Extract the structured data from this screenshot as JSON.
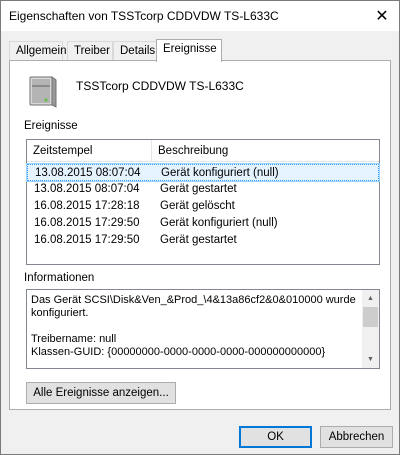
{
  "window": {
    "title": "Eigenschaften von TSSTcorp CDDVDW TS-L633C",
    "close_glyph": "✕"
  },
  "tabs": [
    {
      "label": "Allgemein"
    },
    {
      "label": "Treiber"
    },
    {
      "label": "Details"
    },
    {
      "label": "Ereignisse",
      "active": true
    }
  ],
  "device": {
    "icon": "computer-drive-icon",
    "name": "TSSTcorp CDDVDW TS-L633C"
  },
  "events": {
    "group_label": "Ereignisse",
    "columns": [
      "Zeitstempel",
      "Beschreibung"
    ],
    "rows": [
      {
        "timestamp": "13.08.2015 08:07:04",
        "description": "Gerät konfiguriert (null)",
        "selected": true
      },
      {
        "timestamp": "13.08.2015 08:07:04",
        "description": "Gerät gestartet"
      },
      {
        "timestamp": "16.08.2015 17:28:18",
        "description": "Gerät gelöscht"
      },
      {
        "timestamp": "16.08.2015 17:29:50",
        "description": "Gerät konfiguriert (null)"
      },
      {
        "timestamp": "16.08.2015 17:29:50",
        "description": "Gerät gestartet"
      }
    ]
  },
  "info": {
    "group_label": "Informationen",
    "text": "Das Gerät SCSI\\Disk&Ven_&Prod_\\4&13a86cf2&0&010000 wurde konfiguriert.\n\nTreibername: null\nKlassen-GUID: {00000000-0000-0000-0000-000000000000}"
  },
  "buttons": {
    "show_all": "Alle Ereignisse anzeigen...",
    "ok": "OK",
    "cancel": "Abbrechen"
  }
}
